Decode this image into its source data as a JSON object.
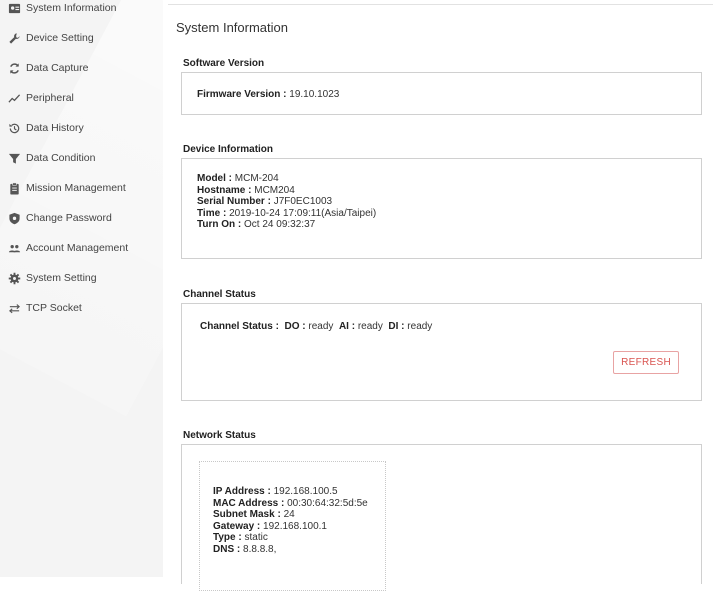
{
  "sidebar": {
    "items": [
      {
        "label": "System Information",
        "icon": "id-card-icon"
      },
      {
        "label": "Device Setting",
        "icon": "wrench-icon"
      },
      {
        "label": "Data Capture",
        "icon": "refresh-cycle-icon"
      },
      {
        "label": "Peripheral",
        "icon": "signal-wave-icon"
      },
      {
        "label": "Data History",
        "icon": "history-icon"
      },
      {
        "label": "Data Condition",
        "icon": "filter-icon"
      },
      {
        "label": "Mission Management",
        "icon": "clipboard-icon"
      },
      {
        "label": "Change Password",
        "icon": "shield-icon"
      },
      {
        "label": "Account Management",
        "icon": "users-icon"
      },
      {
        "label": "System Setting",
        "icon": "gear-icon"
      },
      {
        "label": "TCP Socket",
        "icon": "transfer-arrows-icon"
      }
    ]
  },
  "main": {
    "title": "System Information",
    "software": {
      "title": "Software Version",
      "firmware_label": "Firmware Version :",
      "firmware_value": "19.10.1023"
    },
    "device": {
      "title": "Device Information",
      "fields": [
        {
          "label": "Model :",
          "value": "MCM-204"
        },
        {
          "label": "Hostname :",
          "value": "MCM204"
        },
        {
          "label": "Serial Number :",
          "value": "J7F0EC1003"
        },
        {
          "label": "Time :",
          "value": "2019-10-24 17:09:11(Asia/Taipei)"
        },
        {
          "label": "Turn On :",
          "value": "Oct 24 09:32:37"
        }
      ]
    },
    "channel": {
      "title": "Channel Status",
      "label": "Channel Status :",
      "do_label": "DO :",
      "do_value": "ready",
      "ai_label": "AI :",
      "ai_value": "ready",
      "di_label": "DI :",
      "di_value": "ready",
      "refresh_label": "REFRESH"
    },
    "network": {
      "title": "Network Status",
      "fields": [
        {
          "label": "IP Address :",
          "value": "192.168.100.5"
        },
        {
          "label": "MAC Address :",
          "value": "00:30:64:32:5d:5e"
        },
        {
          "label": "Subnet Mask :",
          "value": "24"
        },
        {
          "label": "Gateway :",
          "value": "192.168.100.1"
        },
        {
          "label": "Type :",
          "value": "static"
        },
        {
          "label": "DNS :",
          "value": "8.8.8.8,"
        }
      ]
    }
  },
  "colors": {
    "sidebar_bg": "#f4f4f4",
    "refresh_accent": "#d9534f",
    "panel_border": "#d0d0d0"
  }
}
